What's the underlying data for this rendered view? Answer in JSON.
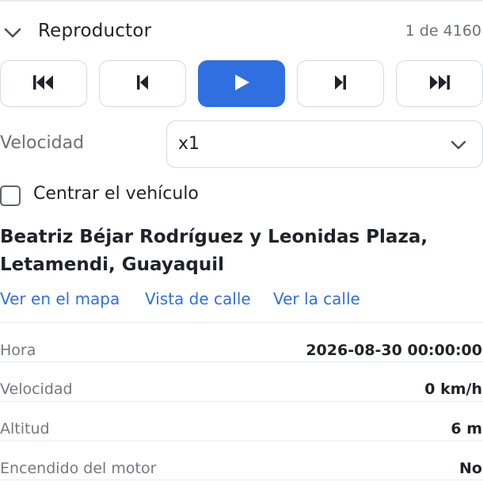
{
  "header": {
    "title": "Reproductor",
    "counter": "1 de 4160"
  },
  "controls": {
    "buttons": [
      {
        "name": "skip-to-start",
        "icon": "skip-to-start-icon"
      },
      {
        "name": "step-back",
        "icon": "step-back-icon"
      },
      {
        "name": "play",
        "icon": "play-icon"
      },
      {
        "name": "step-forward",
        "icon": "step-forward-icon"
      },
      {
        "name": "skip-to-end",
        "icon": "skip-to-end-icon"
      }
    ],
    "accent_color": "#2f6fe0"
  },
  "speed": {
    "label": "Velocidad",
    "value": "x1"
  },
  "center_vehicle": {
    "label": "Centrar el vehículo",
    "checked": false
  },
  "address": {
    "line1": "Beatriz Béjar Rodríguez y Leonidas Plaza,",
    "line2": "Letamendi, Guayaquil"
  },
  "links": {
    "map": "Ver en el mapa",
    "street_view": "Vista de calle",
    "street": "Ver la calle"
  },
  "details": [
    {
      "label": "Hora",
      "value": "2026-08-30 00:00:00"
    },
    {
      "label": "Velocidad",
      "value": "0 km/h"
    },
    {
      "label": "Altitud",
      "value": "6 m"
    },
    {
      "label": "Encendido del motor",
      "value": "No"
    }
  ]
}
